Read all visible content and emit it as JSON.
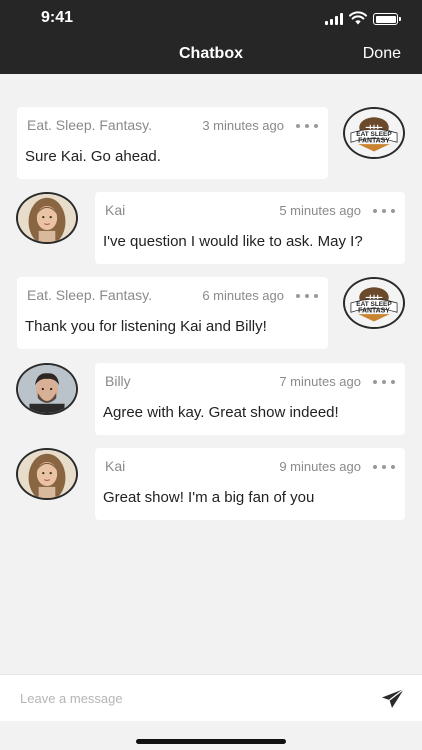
{
  "status_bar": {
    "time": "9:41"
  },
  "header": {
    "title": "Chatbox",
    "done_label": "Done"
  },
  "messages": [
    {
      "author": "Eat. Sleep. Fantasy.",
      "time": "3 minutes ago",
      "text": "Sure Kai. Go ahead.",
      "side": "right",
      "avatar": "eat-sleep-fantasy-logo"
    },
    {
      "author": "Kai",
      "time": "5 minutes ago",
      "text": "I've question I would like to ask. May I?",
      "side": "left",
      "avatar": "kai-photo"
    },
    {
      "author": "Eat. Sleep. Fantasy.",
      "time": "6 minutes ago",
      "text": "Thank you for listening Kai and Billy!",
      "side": "right",
      "avatar": "eat-sleep-fantasy-logo"
    },
    {
      "author": "Billy",
      "time": "7 minutes ago",
      "text": "Agree with kay. Great show indeed!",
      "side": "left",
      "avatar": "billy-photo"
    },
    {
      "author": "Kai",
      "time": "9 minutes ago",
      "text": "Great show! I'm a big fan of you",
      "side": "left",
      "avatar": "kai-photo"
    }
  ],
  "logo": {
    "line1": "EAT SLEEP",
    "line2": "FANTASY"
  },
  "composer": {
    "placeholder": "Leave a message",
    "send_icon": "paper-plane-icon"
  },
  "colors": {
    "header_bg": "#262626",
    "page_bg": "#f2f2f2",
    "bubble_bg": "#ffffff",
    "meta_text": "#8a8a8a"
  }
}
